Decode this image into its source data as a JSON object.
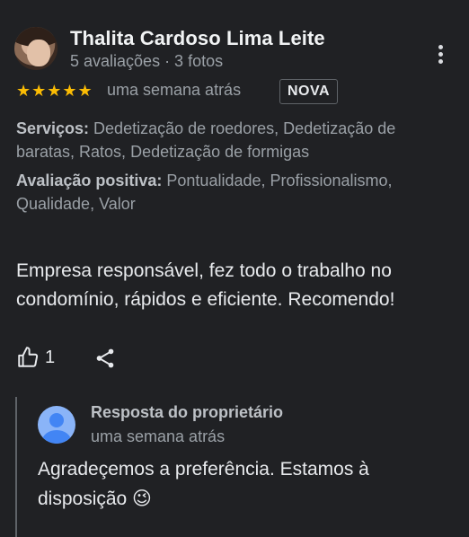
{
  "review": {
    "author_name": "Thalita Cardoso Lima Leite",
    "author_meta": "5 avaliações · 3 fotos",
    "stars": "★★★★★",
    "rating": 5,
    "date": "uma semana atrás",
    "badge": "NOVA",
    "services_label": "Serviços:",
    "services_value": " Dedetização de roedores, Dedetização de baratas, Ratos, Dedetização de formigas",
    "positive_label": "Avaliação positiva:",
    "positive_value": " Pontualidade, Profissionalismo, Qualidade, Valor",
    "text": "Empresa responsável, fez todo o trabalho no condomínio, rápidos e eficiente. Recomendo!",
    "like_count": "1"
  },
  "owner_reply": {
    "title": "Resposta do proprietário",
    "date": "uma semana atrás",
    "text": "Agradeçemos a preferência. Estamos à disposição 😉"
  },
  "colors": {
    "background": "#202124",
    "star": "#fbbc04",
    "owner_avatar": "#8ab4f8"
  }
}
